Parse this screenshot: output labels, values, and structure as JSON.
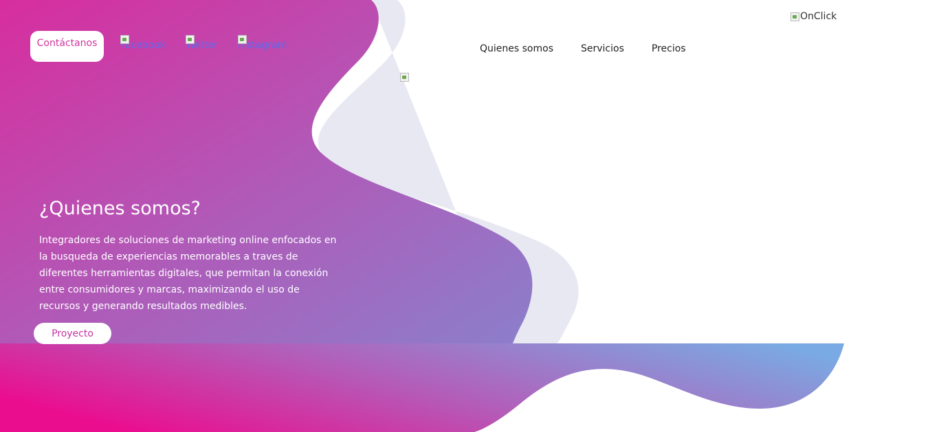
{
  "header": {
    "contact_label": "Contáctanos",
    "social": {
      "facebook": "Facebook",
      "twitter": "Twitter",
      "instagram": "Instagram"
    },
    "brand_alt": "OnClick",
    "nav": [
      "Quienes somos",
      "Servicios",
      "Precios"
    ]
  },
  "hero": {
    "title": "¿Quienes somos?",
    "text": "Integradores de soluciones de marketing online enfocados en la busqueda de experiencias memorables a traves de diferentes herramientas digitales, que permitan la conexión entre consumidores y marcas, maximizando el uso de recursos y generando resultados medibles.",
    "button_label": "Proyecto"
  },
  "colors": {
    "gradient_start": "#ea0e8f",
    "gradient_mid": "#b45cb8",
    "gradient_end": "#7aaae3",
    "wave_light": "#e8e8f3",
    "accent_text": "#d3339d"
  }
}
